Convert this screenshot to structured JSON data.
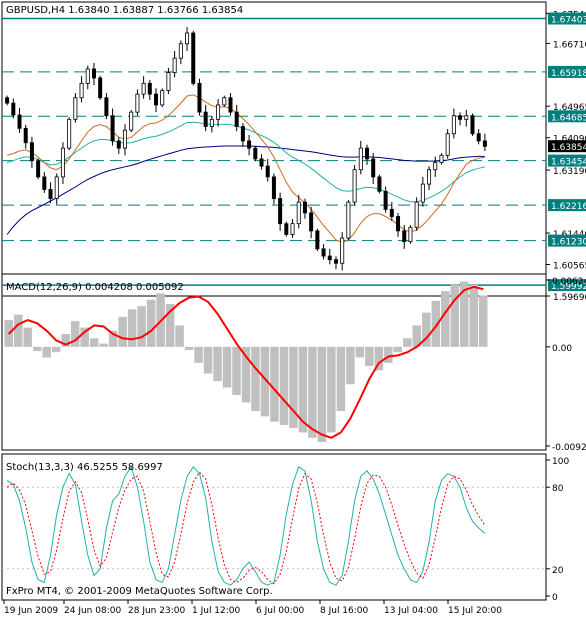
{
  "price_panel": {
    "label": "GBPUSD,H4  1.63840 1.63887 1.63766 1.63854",
    "price_ticks": [
      "1.67540",
      "1.66710",
      "1.64965",
      "1.64090",
      "1.63190",
      "1.61440",
      "1.60565",
      "1.59690"
    ],
    "level_tags": [
      {
        "text": "1.67403",
        "value": 1.67403
      },
      {
        "text": "1.65918",
        "value": 1.65918
      },
      {
        "text": "1.64685",
        "value": 1.64685
      },
      {
        "text": "1.63454",
        "value": 1.63454
      },
      {
        "text": "1.62216",
        "value": 1.62216
      },
      {
        "text": "1.61230",
        "value": 1.6123
      },
      {
        "text": "1.59992",
        "value": 1.59992
      }
    ],
    "current_price": {
      "text": "1.63854",
      "value": 1.63854
    },
    "ylim": [
      1.5969,
      1.6775
    ]
  },
  "macd_panel": {
    "label": "MACD(12,26,9) 0.004208 0.005092",
    "ticks": [
      "0.006247",
      "0.00",
      "-0.00927"
    ],
    "ylim": [
      -0.00927,
      0.006247
    ]
  },
  "stoch_panel": {
    "label": "Stoch(13,3,3) 46.5255 58.6997",
    "ticks": [
      "100",
      "80",
      "20",
      "0"
    ],
    "ylim": [
      0,
      100
    ]
  },
  "watermark": "FxPro MT4, © 2001-2009 MetaQuotes Software Corp.",
  "time_labels": [
    "19 Jun 2009",
    "24 Jun 08:00",
    "28 Jun 23:00",
    "1 Jul 12:00",
    "6 Jul 00:00",
    "8 Jul 16:00",
    "13 Jul 04:00",
    "15 Jul 20:00"
  ],
  "colors": {
    "level_line": "#007f7f",
    "macd_hist": "#c0c0c0",
    "macd_signal": "#ff0000",
    "ma_blue": "#000080",
    "ma_teal": "#20b2aa",
    "ma_orange": "#d2691e",
    "stoch_main": "#20b2aa",
    "stoch_signal": "#ff0000"
  },
  "chart_data": [
    {
      "type": "candlestick",
      "title": "GBPUSD,H4",
      "ylim": [
        1.5969,
        1.6775
      ],
      "close": [
        1.6505,
        1.6472,
        1.6435,
        1.6395,
        1.6345,
        1.63,
        1.6265,
        1.624,
        1.63,
        1.638,
        1.646,
        1.652,
        1.656,
        1.66,
        1.6575,
        1.652,
        1.647,
        1.64,
        1.638,
        1.643,
        1.648,
        1.653,
        1.656,
        1.653,
        1.65,
        1.654,
        1.659,
        1.663,
        1.667,
        1.67,
        1.656,
        1.648,
        1.644,
        1.646,
        1.65,
        1.652,
        1.648,
        1.644,
        1.64,
        1.638,
        1.635,
        1.633,
        1.63,
        1.624,
        1.617,
        1.614,
        1.617,
        1.623,
        1.62,
        1.615,
        1.61,
        1.608,
        1.607,
        1.606,
        1.613,
        1.623,
        1.632,
        1.638,
        1.635,
        1.63,
        1.626,
        1.621,
        1.619,
        1.615,
        1.612,
        1.616,
        1.623,
        1.628,
        1.632,
        1.634,
        1.636,
        1.642,
        1.647,
        1.646,
        1.647,
        1.642,
        1.64,
        1.6385
      ],
      "series": [
        {
          "name": "ma_blue",
          "values": [
            1.614,
            1.6162,
            1.618,
            1.6195,
            1.6206,
            1.6215,
            1.6224,
            1.6233,
            1.6242,
            1.6252,
            1.6262,
            1.6272,
            1.6283,
            1.6293,
            1.6301,
            1.6309,
            1.6315,
            1.632,
            1.6324,
            1.6328,
            1.6332,
            1.6337,
            1.6343,
            1.6349,
            1.6354,
            1.6359,
            1.6364,
            1.6369,
            1.6374,
            1.6378,
            1.638,
            1.6382,
            1.6383,
            1.6384,
            1.6385,
            1.6386,
            1.6386,
            1.6386,
            1.6386,
            1.6386,
            1.6385,
            1.6384,
            1.6383,
            1.6382,
            1.638,
            1.6378,
            1.6376,
            1.6374,
            1.6372,
            1.637,
            1.6367,
            1.6364,
            1.6361,
            1.6358,
            1.6356,
            1.6355,
            1.6355,
            1.6356,
            1.6356,
            1.6355,
            1.6354,
            1.6352,
            1.635,
            1.6348,
            1.6346,
            1.6345,
            1.6344,
            1.6344,
            1.6344,
            1.6344,
            1.6345,
            1.6347,
            1.635,
            1.6353,
            1.6355,
            1.6356,
            1.6357,
            1.6357
          ]
        },
        {
          "name": "ma_teal",
          "values": [
            1.634,
            1.6345,
            1.6352,
            1.6356,
            1.6354,
            1.6348,
            1.634,
            1.6333,
            1.6335,
            1.6343,
            1.6355,
            1.6368,
            1.638,
            1.6392,
            1.64,
            1.6404,
            1.6404,
            1.64,
            1.6396,
            1.6394,
            1.6395,
            1.64,
            1.6406,
            1.641,
            1.6413,
            1.6418,
            1.6425,
            1.6433,
            1.6442,
            1.6451,
            1.6452,
            1.645,
            1.6447,
            1.6446,
            1.6446,
            1.6446,
            1.6445,
            1.6441,
            1.6436,
            1.643,
            1.6423,
            1.6415,
            1.6407,
            1.6396,
            1.6382,
            1.6367,
            1.6355,
            1.6346,
            1.6336,
            1.6324,
            1.631,
            1.6296,
            1.6283,
            1.627,
            1.6262,
            1.626,
            1.6263,
            1.6268,
            1.6271,
            1.627,
            1.6266,
            1.6259,
            1.6252,
            1.6244,
            1.6236,
            1.6231,
            1.6231,
            1.6235,
            1.6242,
            1.625,
            1.626,
            1.6272,
            1.6287,
            1.63,
            1.6312,
            1.6319,
            1.6324,
            1.6328
          ]
        },
        {
          "name": "ma_orange",
          "values": [
            1.636,
            1.6365,
            1.6372,
            1.6375,
            1.6368,
            1.6355,
            1.634,
            1.6325,
            1.632,
            1.633,
            1.635,
            1.6375,
            1.64,
            1.6425,
            1.644,
            1.6445,
            1.644,
            1.6425,
            1.641,
            1.6405,
            1.641,
            1.6425,
            1.644,
            1.6448,
            1.645,
            1.6458,
            1.647,
            1.6487,
            1.6505,
            1.6525,
            1.6528,
            1.652,
            1.6508,
            1.6498,
            1.6494,
            1.6495,
            1.649,
            1.6478,
            1.6462,
            1.6445,
            1.6425,
            1.6405,
            1.6383,
            1.6355,
            1.632,
            1.6285,
            1.6258,
            1.6242,
            1.6228,
            1.621,
            1.6188,
            1.6165,
            1.6145,
            1.6125,
            1.6118,
            1.6125,
            1.6145,
            1.6172,
            1.619,
            1.6198,
            1.6198,
            1.619,
            1.618,
            1.6167,
            1.6153,
            1.6147,
            1.6152,
            1.6166,
            1.6185,
            1.6205,
            1.6225,
            1.6252,
            1.6283,
            1.631,
            1.6335,
            1.6346,
            1.6352,
            1.6355
          ]
        }
      ],
      "horizontal_levels": [
        1.67403,
        1.65918,
        1.64685,
        1.63454,
        1.62216,
        1.6123,
        1.59992
      ]
    },
    {
      "type": "bar+line",
      "title": "MACD(12,26,9)",
      "ylim": [
        -0.00927,
        0.006247
      ],
      "series": [
        {
          "name": "macd_histogram",
          "values": [
            0.0025,
            0.003,
            0.0018,
            -0.0004,
            -0.001,
            -0.0005,
            0.0012,
            0.0024,
            0.0018,
            0.0008,
            0.0003,
            0.0015,
            0.0028,
            0.0035,
            0.0038,
            0.0044,
            0.005,
            0.004,
            0.002,
            -0.0003,
            -0.0015,
            -0.0025,
            -0.0032,
            -0.0038,
            -0.0045,
            -0.0052,
            -0.006,
            -0.0065,
            -0.007,
            -0.0073,
            -0.0076,
            -0.008,
            -0.0085,
            -0.0089,
            -0.008,
            -0.006,
            -0.0035,
            -0.001,
            -0.0018,
            -0.0022,
            -0.0015,
            -0.0005,
            0.0008,
            0.002,
            0.0032,
            0.0043,
            0.0052,
            0.0058,
            0.0061,
            0.0058,
            0.0048
          ]
        },
        {
          "name": "macd_signal",
          "values": [
            0.0012,
            0.0021,
            0.0025,
            0.0022,
            0.0015,
            0.0006,
            0.0002,
            0.0006,
            0.0014,
            0.002,
            0.0019,
            0.0012,
            0.0008,
            0.0007,
            0.0009,
            0.0015,
            0.0024,
            0.0033,
            0.0041,
            0.0046,
            0.0047,
            0.0042,
            0.0031,
            0.0017,
            0.0003,
            -0.0009,
            -0.002,
            -0.003,
            -0.004,
            -0.005,
            -0.006,
            -0.007,
            -0.0077,
            -0.0082,
            -0.0085,
            -0.008,
            -0.0067,
            -0.0049,
            -0.003,
            -0.0015,
            -0.0009,
            -0.0008,
            -0.0005,
            0.0,
            0.0008,
            0.0019,
            0.0032,
            0.0044,
            0.0053,
            0.0056,
            0.0054
          ]
        }
      ]
    },
    {
      "type": "line",
      "title": "Stoch(13,3,3)",
      "ylim": [
        0,
        100
      ],
      "levels": [
        80,
        20
      ],
      "series": [
        {
          "name": "stoch_main",
          "values": [
            85,
            82,
            70,
            50,
            25,
            12,
            10,
            30,
            60,
            80,
            90,
            82,
            55,
            30,
            15,
            20,
            50,
            70,
            75,
            88,
            95,
            80,
            55,
            25,
            12,
            10,
            20,
            45,
            70,
            88,
            95,
            90,
            72,
            40,
            18,
            10,
            8,
            12,
            20,
            25,
            18,
            10,
            8,
            10,
            30,
            60,
            82,
            95,
            92,
            70,
            40,
            20,
            10,
            8,
            15,
            40,
            70,
            88,
            92,
            86,
            75,
            60,
            45,
            30,
            20,
            12,
            10,
            18,
            40,
            70,
            85,
            90,
            88,
            80,
            65,
            55,
            50,
            46
          ]
        },
        {
          "name": "stoch_signal",
          "values": [
            80,
            83,
            78,
            67,
            48,
            29,
            16,
            18,
            34,
            57,
            77,
            84,
            76,
            56,
            34,
            22,
            28,
            47,
            65,
            78,
            86,
            88,
            77,
            55,
            32,
            16,
            14,
            25,
            45,
            68,
            84,
            91,
            86,
            67,
            43,
            23,
            12,
            10,
            13,
            19,
            21,
            18,
            12,
            9,
            16,
            33,
            57,
            79,
            90,
            86,
            68,
            45,
            25,
            13,
            11,
            21,
            42,
            66,
            83,
            89,
            88,
            80,
            67,
            52,
            38,
            26,
            17,
            13,
            23,
            43,
            65,
            82,
            88,
            86,
            78,
            67,
            59,
            52
          ]
        }
      ]
    }
  ]
}
